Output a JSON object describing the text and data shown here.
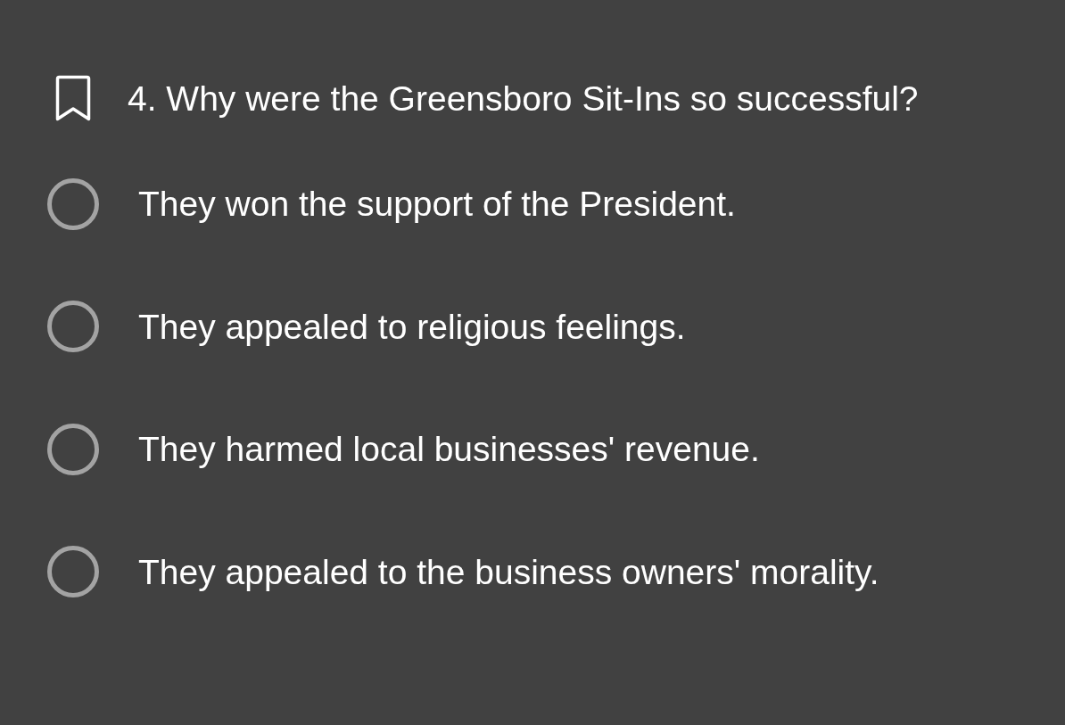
{
  "question": {
    "text": "4. Why were the Greensboro Sit-Ins so successful?",
    "bookmarked": false
  },
  "options": [
    {
      "label": "They won the support of the President.",
      "selected": false
    },
    {
      "label": "They appealed to religious feelings.",
      "selected": false
    },
    {
      "label": "They harmed local businesses' revenue.",
      "selected": false
    },
    {
      "label": "They appealed to the business owners' morality.",
      "selected": false
    }
  ]
}
